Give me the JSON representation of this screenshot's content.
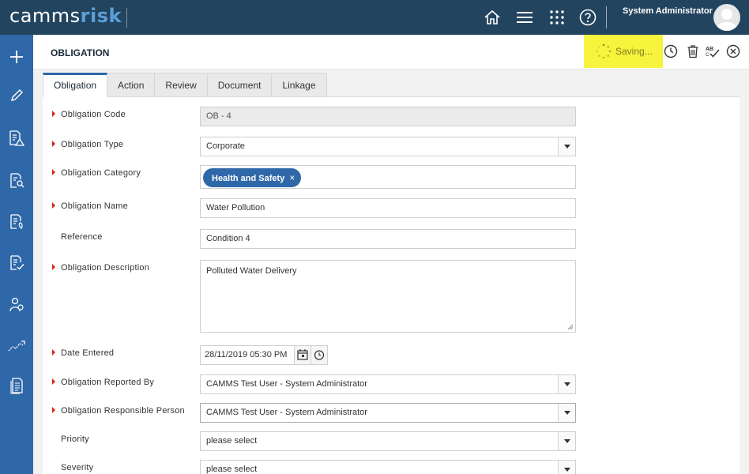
{
  "app": {
    "logo_part1": "camms",
    "logo_part2": "risk",
    "user_name": "System Administrator"
  },
  "topbar_icons": [
    "home-icon",
    "menu-icon",
    "apps-grid-icon",
    "help-icon"
  ],
  "sidebar_icons": [
    "plus-icon",
    "pencil-icon",
    "risk-register-icon",
    "search-document-icon",
    "compliance-document-icon",
    "checklist-document-icon",
    "users-icon",
    "trend-chart-icon",
    "report-document-icon"
  ],
  "header": {
    "title": "OBLIGATION",
    "saving_text": "Saving...",
    "icons": [
      "history-icon",
      "delete-icon",
      "spellcheck-icon",
      "close-icon"
    ]
  },
  "tabs": [
    {
      "label": "Obligation",
      "active": true
    },
    {
      "label": "Action",
      "active": false
    },
    {
      "label": "Review",
      "active": false
    },
    {
      "label": "Document",
      "active": false
    },
    {
      "label": "Linkage",
      "active": false
    }
  ],
  "form": {
    "code": {
      "label": "Obligation Code",
      "value": "OB - 4",
      "required": true
    },
    "type": {
      "label": "Obligation Type",
      "value": "Corporate",
      "required": true
    },
    "category": {
      "label": "Obligation Category",
      "chip": "Health and Safety",
      "chip_remove": "×",
      "required": true
    },
    "name": {
      "label": "Obligation Name",
      "value": "Water Pollution",
      "required": true
    },
    "reference": {
      "label": "Reference",
      "value": "Condition 4",
      "required": false
    },
    "description": {
      "label": "Obligation Description",
      "value": "Polluted Water Delivery",
      "required": true
    },
    "date_entered": {
      "label": "Date Entered",
      "value": "28/11/2019 05:30 PM",
      "required": true
    },
    "reported_by": {
      "label": "Obligation Reported By",
      "value": "CAMMS Test User - System Administrator",
      "required": true
    },
    "responsible": {
      "label": "Obligation Responsible Person",
      "value": "CAMMS Test User - System Administrator",
      "required": true
    },
    "priority": {
      "label": "Priority",
      "value": "please select",
      "required": false
    },
    "severity": {
      "label": "Severity",
      "value": "please select",
      "required": false
    }
  },
  "colors": {
    "topbar": "#23445f",
    "sidebar": "#2f68a8",
    "saving_highlight": "#f7f43d",
    "required_marker": "#d7261e",
    "chip": "#2f68a8"
  }
}
